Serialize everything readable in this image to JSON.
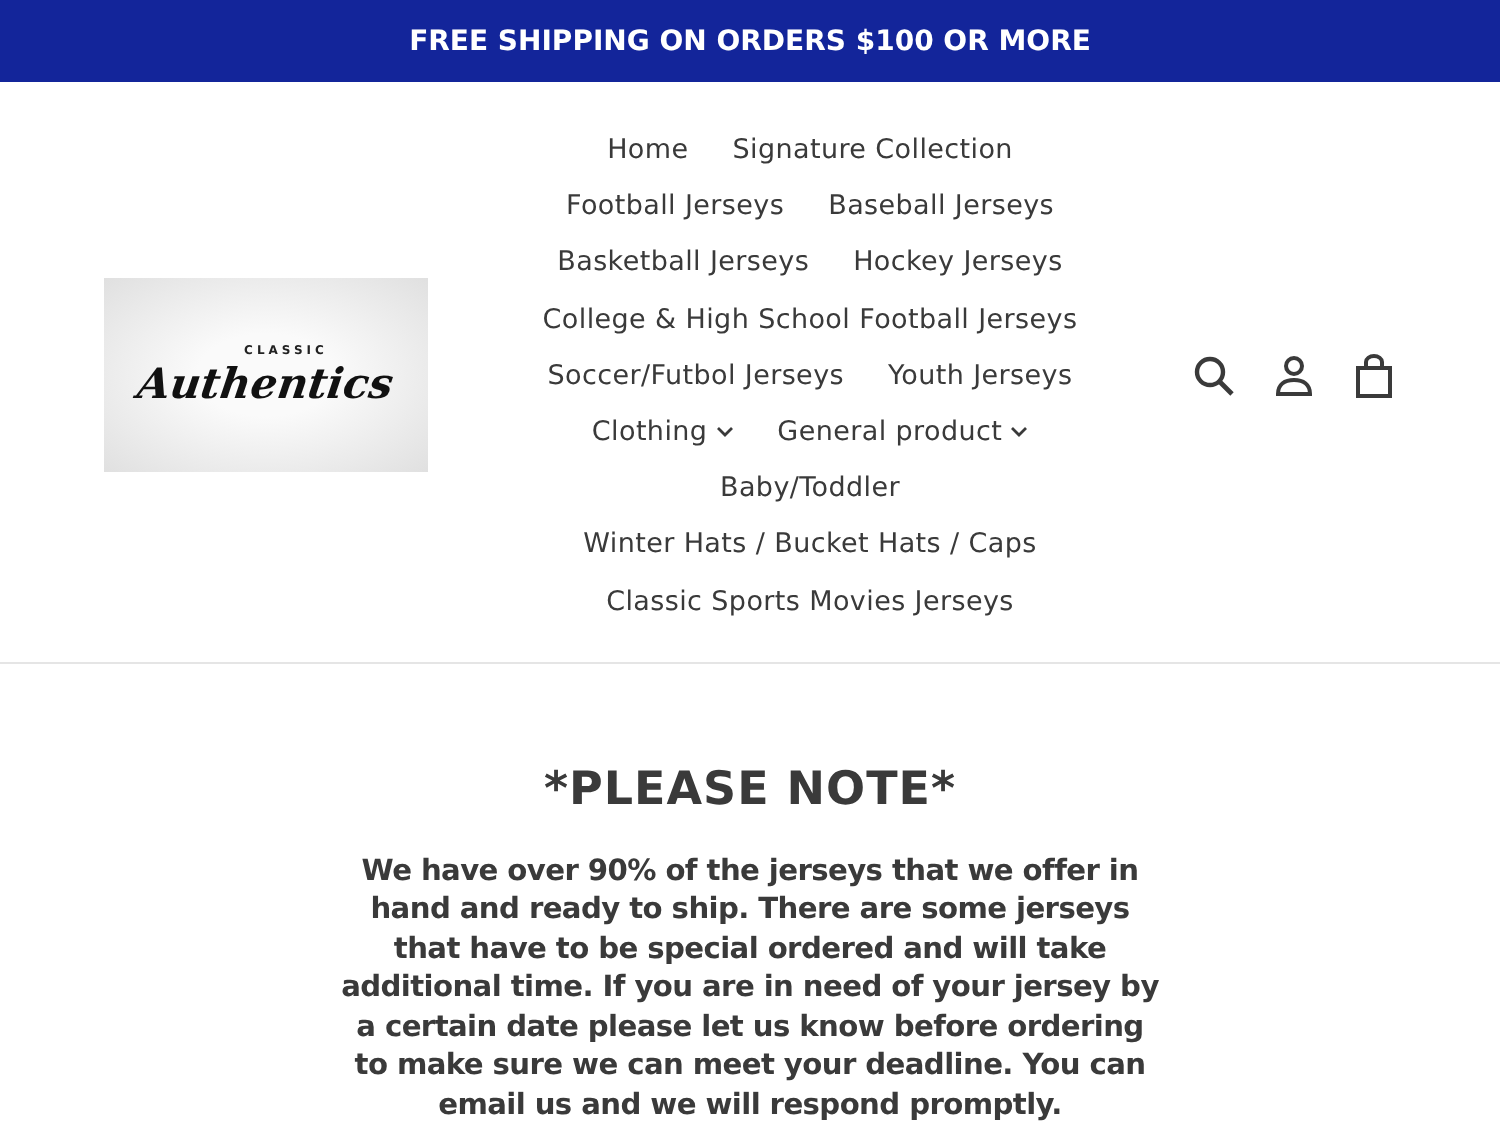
{
  "announcement": "FREE SHIPPING ON ORDERS $100 OR MORE",
  "logo": {
    "small": "CLASSIC",
    "main": "Authentics"
  },
  "nav_rows": [
    [
      {
        "label": "Home",
        "dropdown": false
      },
      {
        "label": "Signature Collection",
        "dropdown": false
      }
    ],
    [
      {
        "label": "Football Jerseys",
        "dropdown": false
      },
      {
        "label": "Baseball Jerseys",
        "dropdown": false
      }
    ],
    [
      {
        "label": "Basketball Jerseys",
        "dropdown": false
      },
      {
        "label": "Hockey Jerseys",
        "dropdown": false
      }
    ],
    [
      {
        "label": "College & High School Football Jerseys",
        "dropdown": false
      }
    ],
    [
      {
        "label": "Soccer/Futbol Jerseys",
        "dropdown": false
      },
      {
        "label": "Youth Jerseys",
        "dropdown": false
      }
    ],
    [
      {
        "label": "Clothing",
        "dropdown": true
      },
      {
        "label": "General product",
        "dropdown": true
      }
    ],
    [
      {
        "label": "Baby/Toddler",
        "dropdown": false
      }
    ],
    [
      {
        "label": "Winter Hats / Bucket Hats / Caps",
        "dropdown": false
      }
    ],
    [
      {
        "label": "Classic Sports Movies Jerseys",
        "dropdown": false
      }
    ]
  ],
  "note": {
    "title": "*PLEASE NOTE*",
    "body": "We have over 90% of the jerseys that we offer in hand and ready to ship. There are some jerseys that have to be special ordered and will take additional time. If you are in need of your jersey by a certain date please let us know before ordering to make sure we can meet your deadline. You can email us and we will respond promptly."
  }
}
